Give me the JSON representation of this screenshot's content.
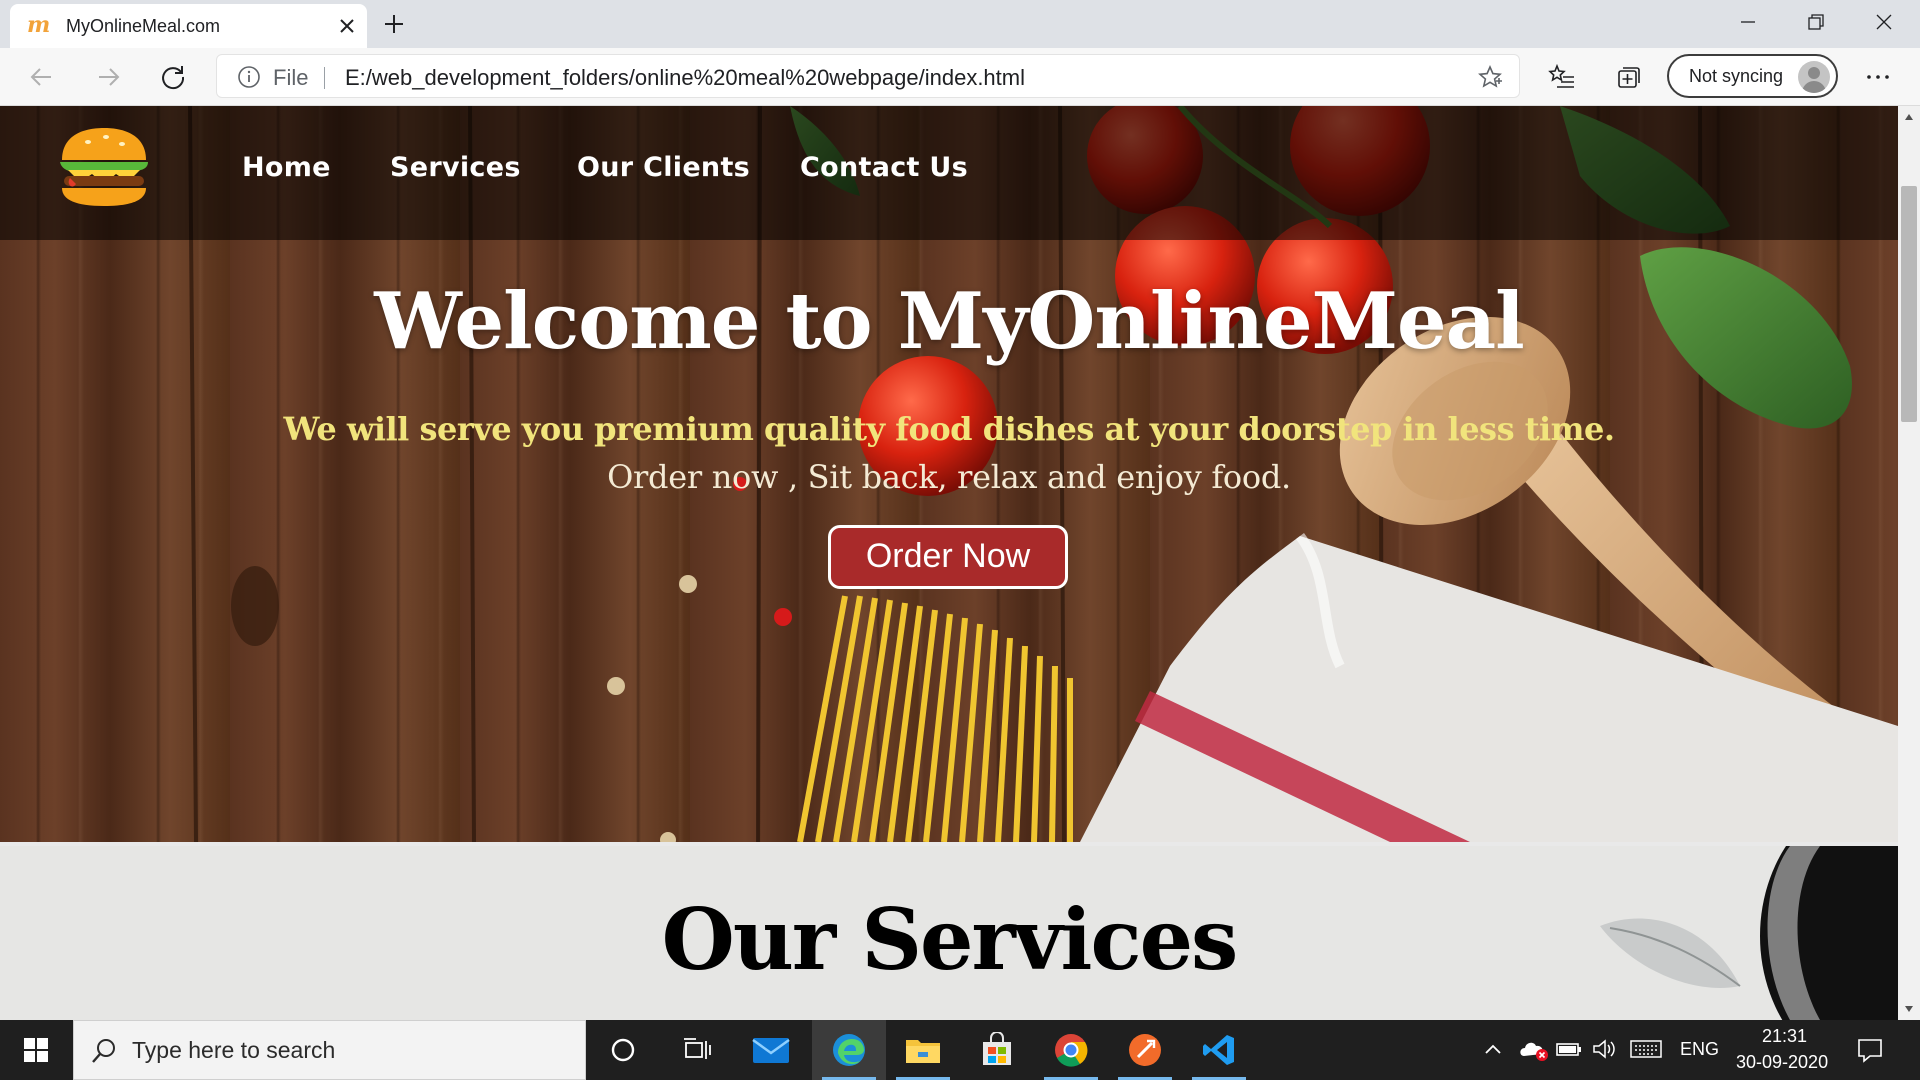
{
  "browser": {
    "tab": {
      "favicon_glyph": "m",
      "title": "MyOnlineMeal.com"
    },
    "address": {
      "scheme_label": "File",
      "url": "E:/web_development_folders/online%20meal%20webpage/index.html"
    },
    "profile": {
      "label": "Not syncing"
    }
  },
  "page": {
    "nav": [
      "Home",
      "Services",
      "Our Clients",
      "Contact Us"
    ],
    "hero": {
      "title": "Welcome to MyOnlineMeal",
      "subtitle": "We will serve you premium quality food dishes at your doorstep in less time.",
      "tagline": "Order now , Sit back, relax and enjoy food.",
      "cta_label": "Order Now"
    },
    "services": {
      "title": "Our Services"
    }
  },
  "taskbar": {
    "search_placeholder": "Type here to search",
    "language": "ENG",
    "time": "21:31",
    "date": "30-09-2020"
  },
  "colors": {
    "cta_background": "#a92a2a",
    "subtitle_text": "#f1e47c",
    "nav_overlay": "rgba(0,0,0,0.55)",
    "taskbar_background": "#1f1f1f"
  }
}
